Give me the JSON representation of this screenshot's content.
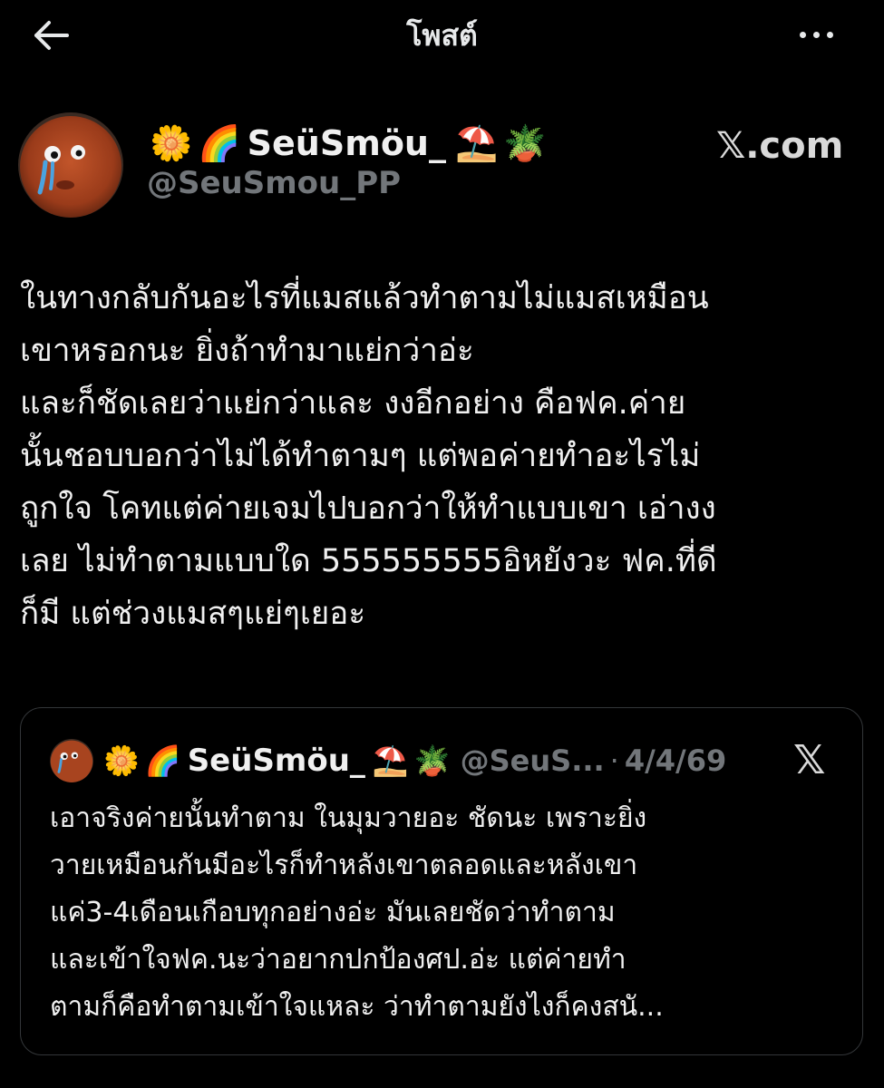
{
  "header": {
    "title": "โพสต์",
    "back_icon": "arrow-left-icon",
    "more_icon": "more-horizontal-icon"
  },
  "post": {
    "display_name": "SeüSmöu_",
    "name_emoji_before": [
      "🌼",
      "🌈"
    ],
    "name_emoji_after": [
      "⛱️",
      "🪴"
    ],
    "handle": "@SeuSmou_PP",
    "brand": "𝕏.com",
    "text_lines": [
      "ในทางกลับกันอะไรที่แมสแล้วทำตามไม่แมสเหมือน",
      "เขาหรอกนะ ยิ่งถ้าทำมาแย่กว่าอ่ะ",
      "และก็ชัดเลยว่าแย่กว่าและ งงอีกอย่าง คือฟค.ค่าย",
      "นั้นชอบบอกว่าไม่ได้ทำตามๆ แต่พอค่ายทำอะไรไม่",
      "ถูกใจ โคทแต่ค่ายเจมไปบอกว่าให้ทำแบบเขา เอ่างง",
      "เลย ไม่ทำตามแบบใด 555555555อิหยังวะ ฟค.ที่ดี",
      "ก็มี แต่ช่วงแมสๆแย่ๆเยอะ"
    ]
  },
  "quote": {
    "display_name": "SeüSmöu_",
    "name_emoji_before": [
      "🌼",
      "🌈"
    ],
    "name_emoji_after": [
      "⛱️",
      "🪴"
    ],
    "handle": "@SeuS...",
    "separator": "·",
    "date": "4/4/69",
    "brand": "𝕏",
    "text_lines": [
      "เอาจริงค่ายนั้นทำตาม ในมุมวายอะ ชัดนะ เพราะยิ่ง",
      "วายเหมือนกันมีอะไรก็ทำหลังเขาตลอดและหลังเขา",
      "แค่3-4เดือนเกือบทุกอย่างอ่ะ  มันเลยชัดว่าทำตาม",
      "และเข้าใจฟค.นะว่าอยากปกป้องศป.อ่ะ แต่ค่ายทำ",
      "ตามก็คือทำตามเข้าใจแหละ ว่าทำตามยังไงก็คงสนั..."
    ]
  },
  "colors": {
    "background": "#000000",
    "text": "#f0f0f0",
    "muted": "#72767a",
    "border": "#333639",
    "avatar_fur": "#a8441f"
  }
}
